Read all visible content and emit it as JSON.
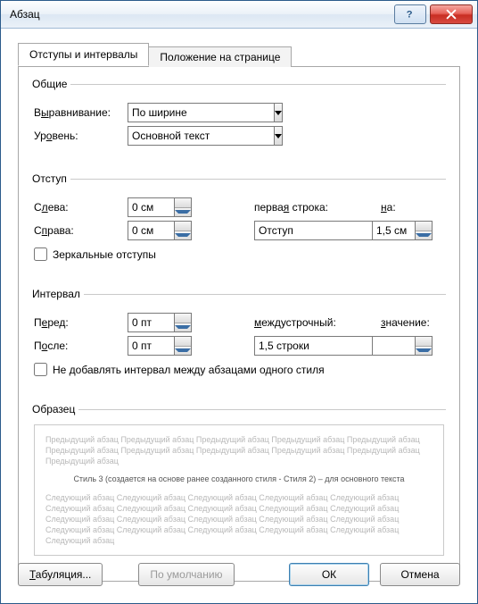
{
  "window": {
    "title": "Абзац"
  },
  "tabs": {
    "intervals": "Отступы и интервалы",
    "position": "Положение на странице"
  },
  "general": {
    "legend": "Общие",
    "alignment_label_pre": "В",
    "alignment_label_hot": "ы",
    "alignment_label_post": "равнивание:",
    "alignment_value": "По ширине",
    "level_label_pre": "Ур",
    "level_label_hot": "о",
    "level_label_post": "вень:",
    "level_value": "Основной текст"
  },
  "indent": {
    "legend": "Отступ",
    "left_label_pre": "С",
    "left_label_hot": "л",
    "left_label_post": "ева:",
    "left_value": "0 см",
    "right_label_pre": "С",
    "right_label_hot": "п",
    "right_label_post": "рава:",
    "right_value": "0 см",
    "firstline_label_pre": "перва",
    "firstline_label_hot": "я",
    "firstline_label_post": " строка:",
    "firstline_value": "Отступ",
    "by_label_pre": "",
    "by_label_hot": "н",
    "by_label_post": "а:",
    "by_value": "1,5 см",
    "mirror_label": "Зеркальные отступы"
  },
  "spacing": {
    "legend": "Интервал",
    "before_label_pre": "П",
    "before_label_hot": "е",
    "before_label_post": "ред:",
    "before_value": "0 пт",
    "after_label_pre": "П",
    "after_label_hot": "о",
    "after_label_post": "сле:",
    "after_value": "0 пт",
    "line_label_pre": "",
    "line_label_hot": "м",
    "line_label_post": "еждустрочный:",
    "line_value": "1,5 строки",
    "at_label_pre": "",
    "at_label_hot": "з",
    "at_label_post": "начение:",
    "at_value": "",
    "nosame_label": "Не добавлять интервал между абзацами одного стиля"
  },
  "sample": {
    "legend": "Образец",
    "prev": "Предыдущий абзац Предыдущий абзац Предыдущий абзац Предыдущий абзац Предыдущий абзац Предыдущий абзац Предыдущий абзац Предыдущий абзац Предыдущий абзац Предыдущий абзац Предыдущий абзац",
    "mid": "Стиль 3 (создается на основе ранее созданного стиля - Стиля 2) – для основного текста",
    "next": "Следующий абзац Следующий абзац Следующий абзац Следующий абзац Следующий абзац Следующий абзац Следующий абзац Следующий абзац Следующий абзац Следующий абзац Следующий абзац Следующий абзац Следующий абзац Следующий абзац Следующий абзац Следующий абзац Следующий абзац Следующий абзац Следующий абзац Следующий абзац Следующий абзац"
  },
  "buttons": {
    "tabs_pre": "",
    "tabs_hot": "Т",
    "tabs_post": "абуляция...",
    "default": "По умолчанию",
    "ok": "ОК",
    "cancel": "Отмена"
  }
}
